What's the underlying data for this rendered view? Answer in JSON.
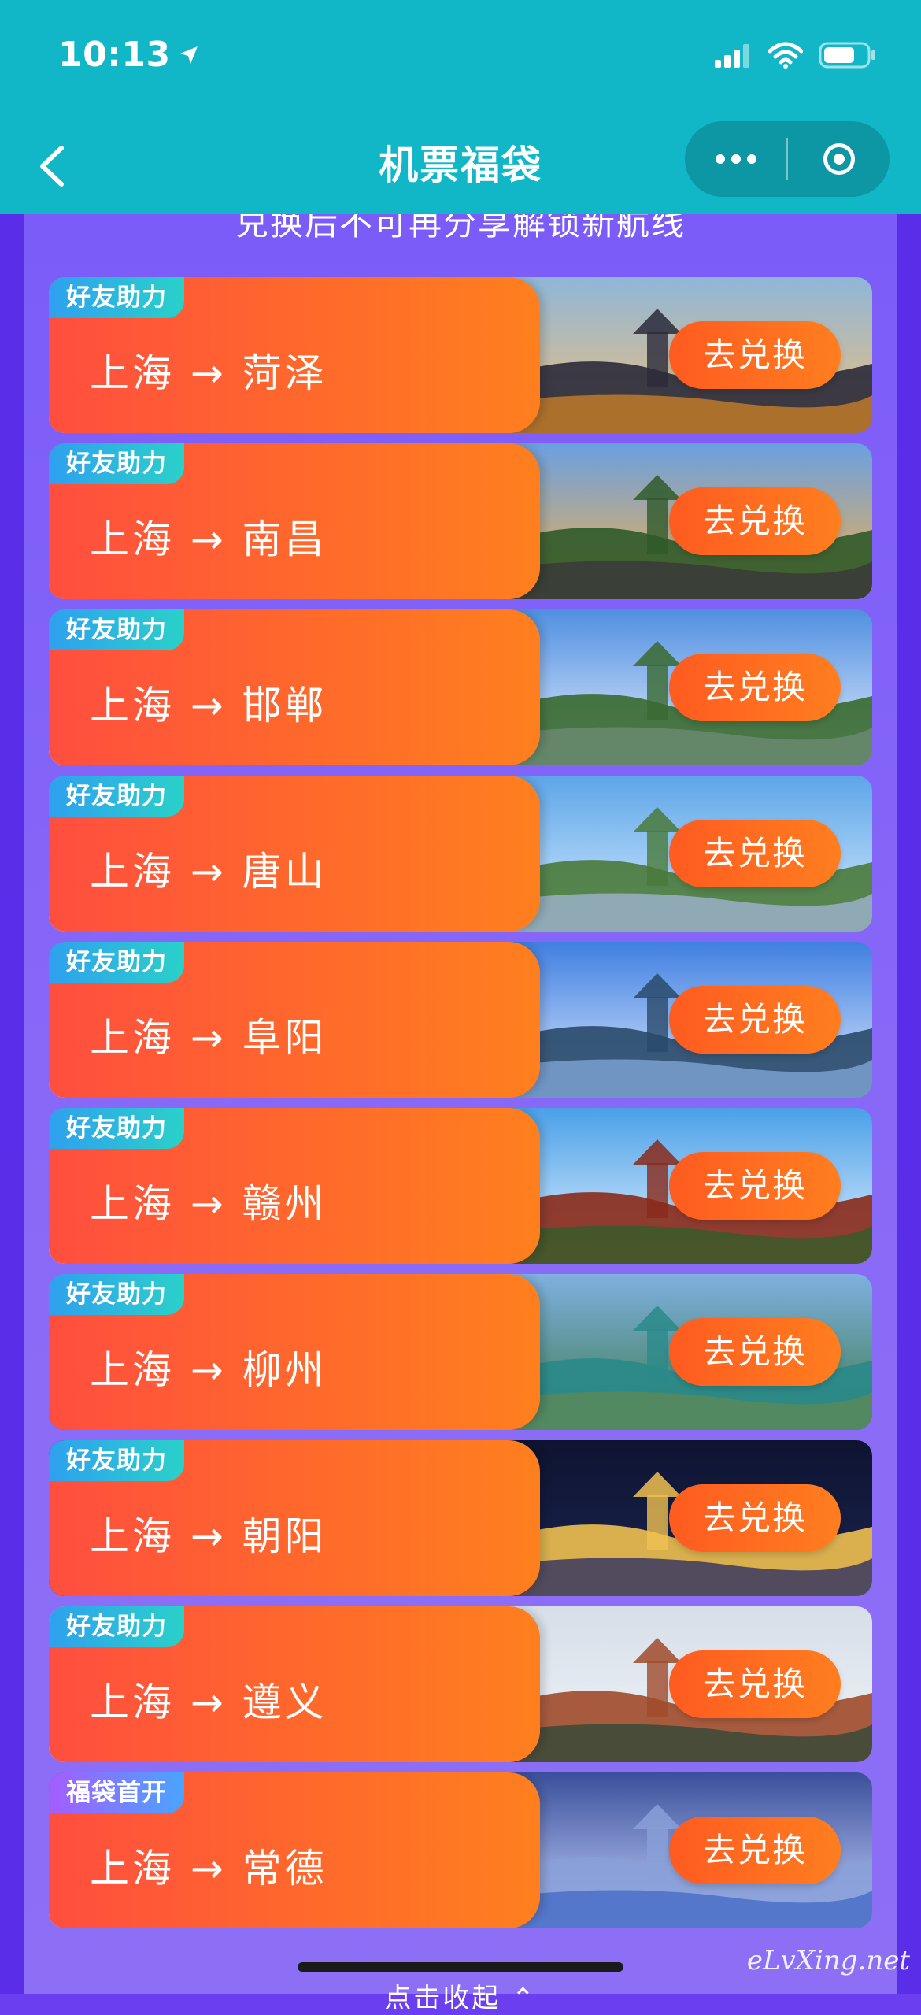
{
  "status_bar": {
    "time": "10:13"
  },
  "nav": {
    "title": "机票福袋"
  },
  "notice": "兑换后不可再分享解锁新航线",
  "button_label": "去兑换",
  "cards": [
    {
      "tag": "好友助力",
      "route": "上海 → 菏泽",
      "scene": "pagoda-lake"
    },
    {
      "tag": "好友助力",
      "route": "上海 → 南昌",
      "scene": "tower-sunset"
    },
    {
      "tag": "好友助力",
      "route": "上海 → 邯郸",
      "scene": "wall-lake"
    },
    {
      "tag": "好友助力",
      "route": "上海 → 唐山",
      "scene": "park-lake"
    },
    {
      "tag": "好友助力",
      "route": "上海 → 阜阳",
      "scene": "pavilion-lake"
    },
    {
      "tag": "好友助力",
      "route": "上海 → 赣州",
      "scene": "red-tower"
    },
    {
      "tag": "好友助力",
      "route": "上海 → 柳州",
      "scene": "river-mountain"
    },
    {
      "tag": "好友助力",
      "route": "上海 → 朝阳",
      "scene": "city-night"
    },
    {
      "tag": "好友助力",
      "route": "上海 → 遵义",
      "scene": "monument"
    },
    {
      "tag": "福袋首开",
      "route": "上海 → 常德",
      "scene": "stone-columns"
    }
  ],
  "bottom_peek": "点击收起 ⌃",
  "watermark": "eLvXing.net",
  "colors": {
    "header": "#11b7c7",
    "background": "#6b3ff0",
    "route_panel": "#ff6a2b",
    "button": "#ff6a1f",
    "tag": "#2ad1c9"
  }
}
